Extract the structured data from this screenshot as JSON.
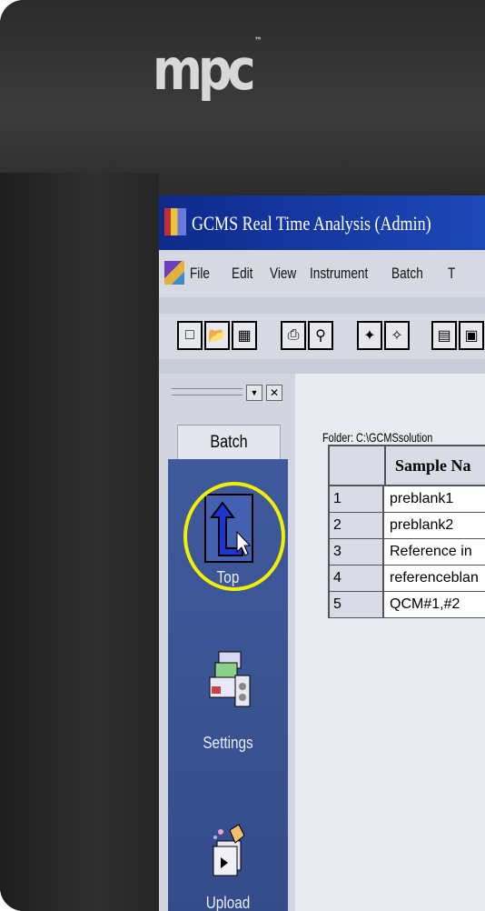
{
  "monitor": {
    "brand": "mpc",
    "brand_tm": "™"
  },
  "window": {
    "title": "GCMS Real Time Analysis (Admin)"
  },
  "menu": {
    "items": [
      "File",
      "Edit",
      "View",
      "Instrument",
      "Batch",
      "T"
    ]
  },
  "toolbar": {
    "buttons": [
      "new-file",
      "open-folder",
      "save",
      "print",
      "print-preview",
      "wizard-1",
      "wizard-2",
      "view-1",
      "view-2"
    ]
  },
  "nav_pane": {
    "header": "Batch",
    "items": [
      {
        "label": "Top",
        "icon": "top-arrow-icon",
        "highlighted": true
      },
      {
        "label": "Settings",
        "icon": "settings-icon"
      },
      {
        "label": "Upload",
        "icon": "upload-icon"
      }
    ],
    "highlight_color": "#f1f000"
  },
  "main": {
    "folder": "Folder: C:\\GCMSsolution",
    "table": {
      "headers": [
        "",
        "Sample Na"
      ],
      "rows": [
        {
          "num": "1",
          "name": "preblank1"
        },
        {
          "num": "2",
          "name": "preblank2"
        },
        {
          "num": "3",
          "name": "Reference in"
        },
        {
          "num": "4",
          "name": "referenceblan"
        },
        {
          "num": "5",
          "name": "QCM#1,#2"
        }
      ]
    }
  }
}
